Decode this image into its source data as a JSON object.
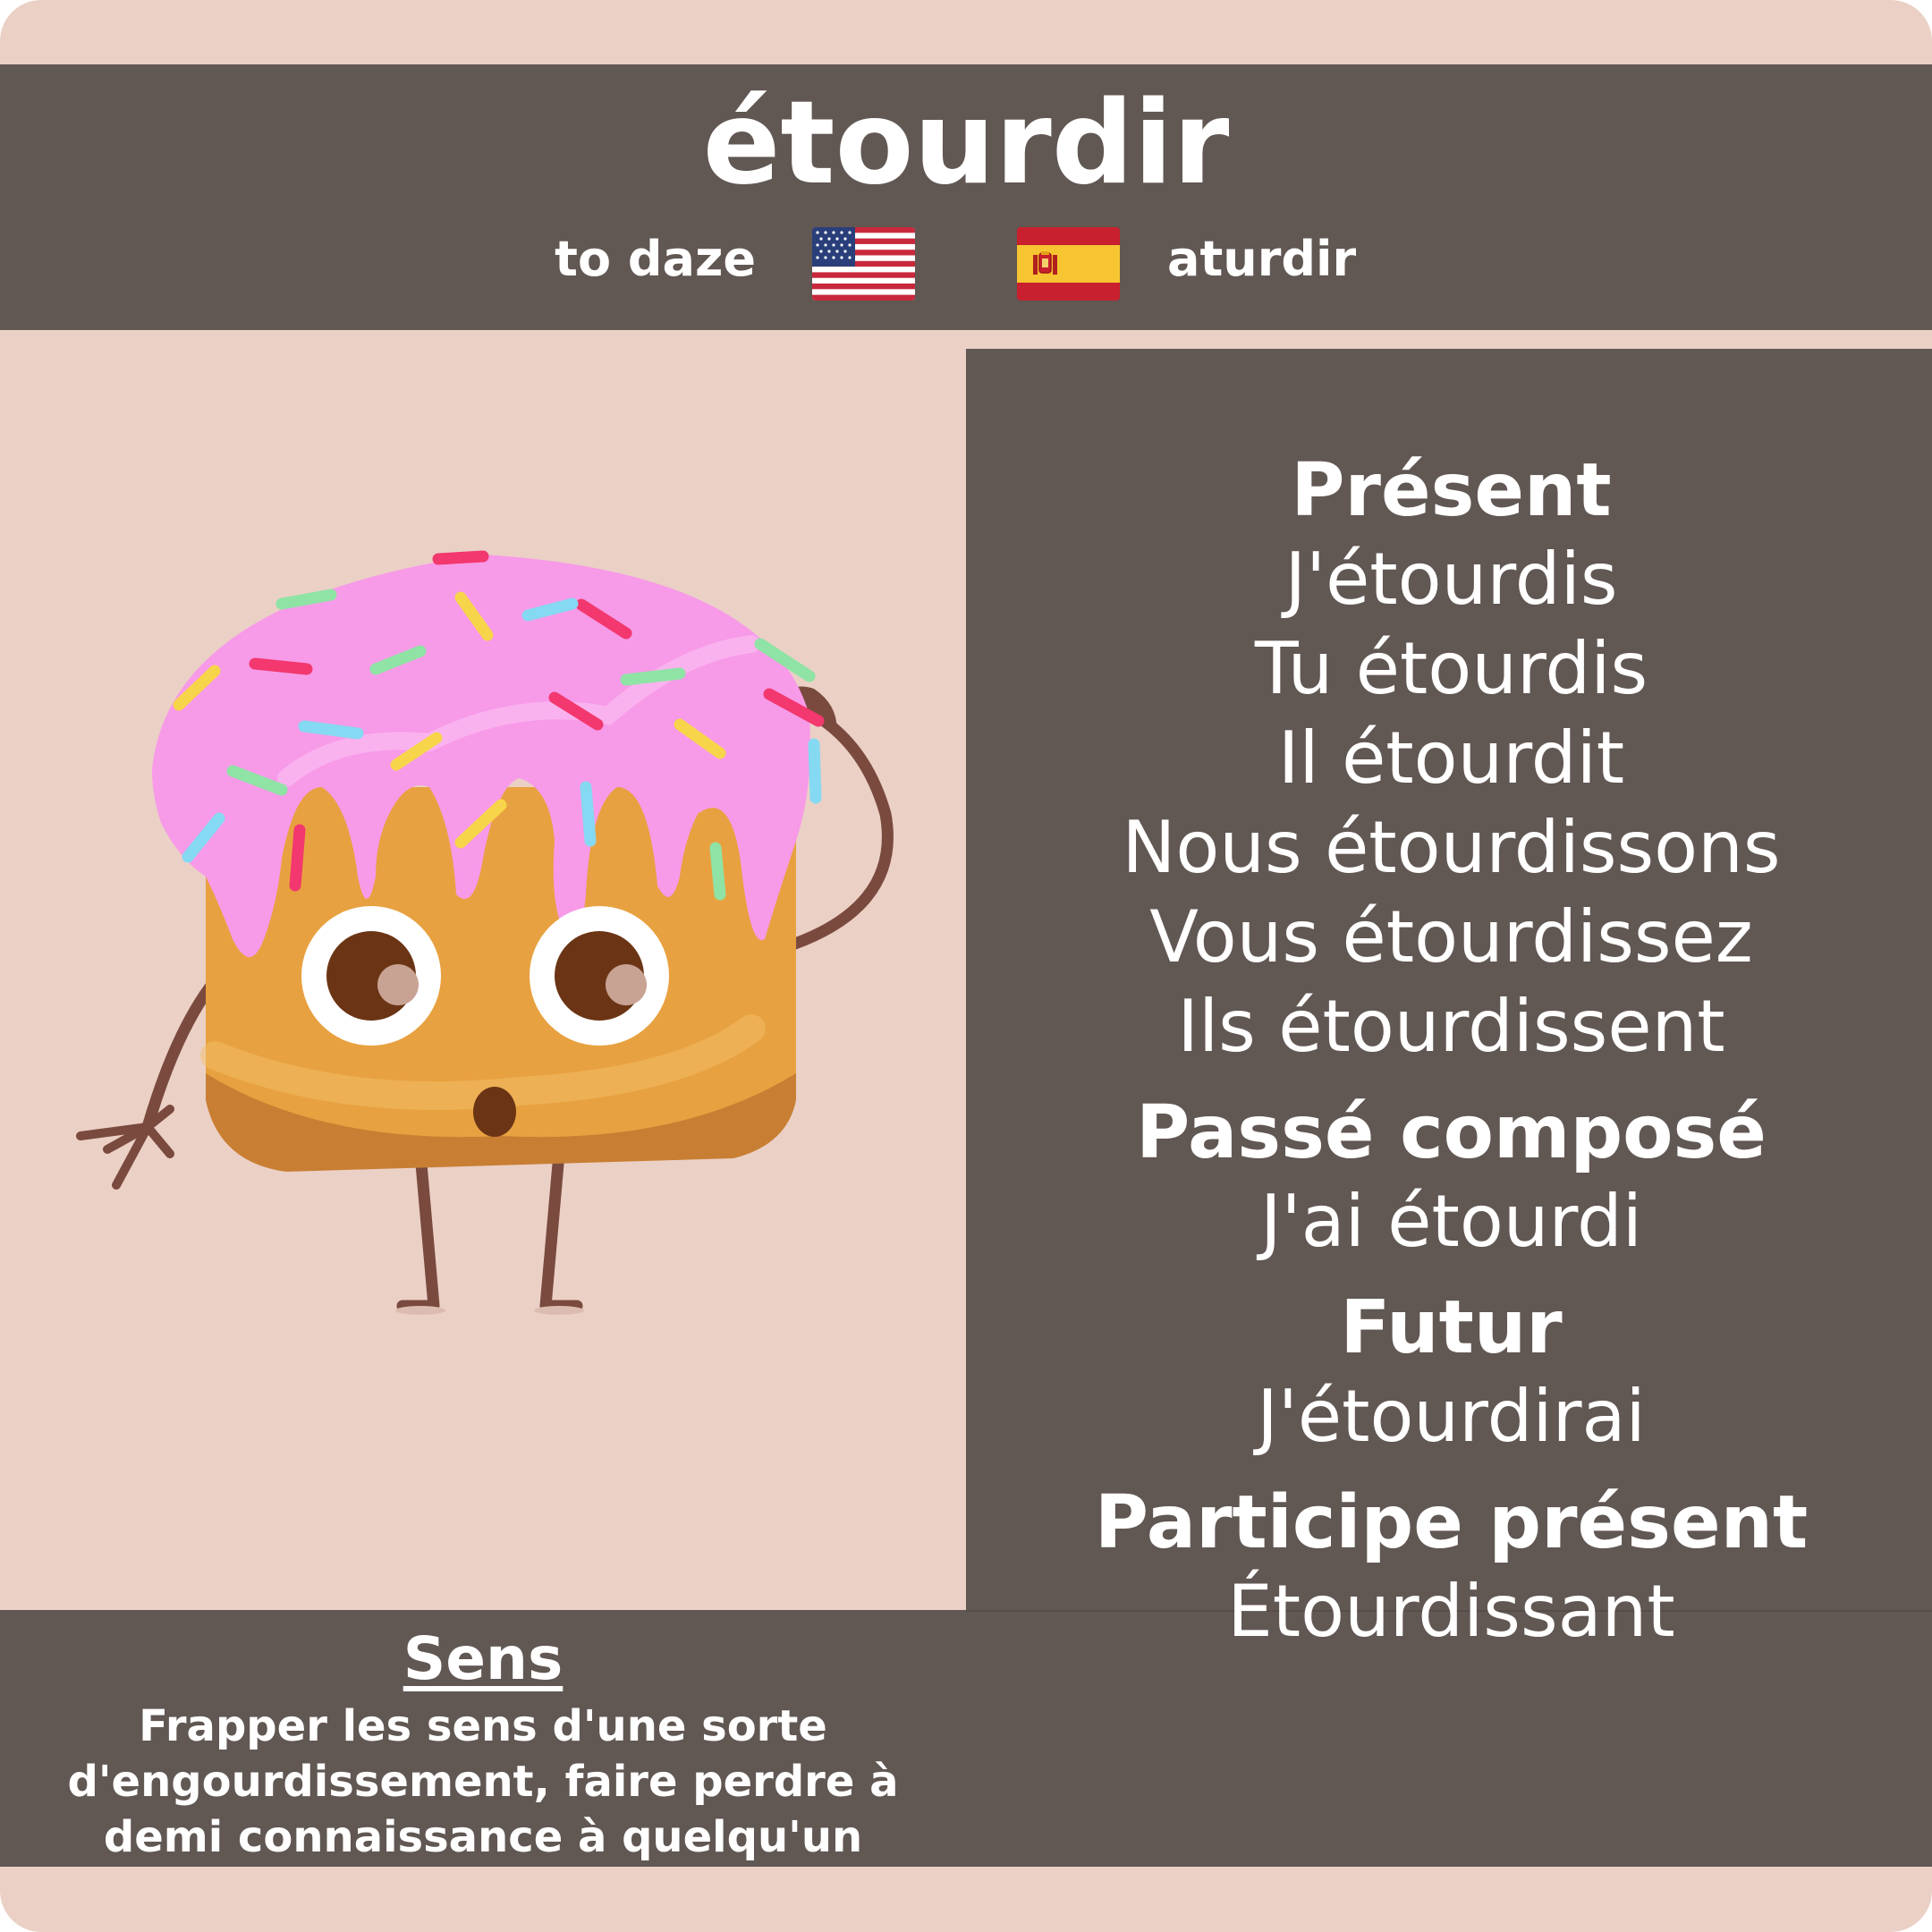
{
  "verb": "étourdir",
  "translations": {
    "english": "to daze",
    "english_flag_icon": "us-flag-icon",
    "spanish": "aturdir",
    "spanish_flag_icon": "spain-flag-icon"
  },
  "illustration": {
    "icon": "dazed-donut-cake-character"
  },
  "conjugations": {
    "present": {
      "heading": "Présent",
      "forms": [
        "J'étourdis",
        "Tu étourdis",
        "Il étourdit",
        "Nous étourdissons",
        "Vous étourdissez",
        "Ils étourdissent"
      ]
    },
    "passe_compose": {
      "heading": "Passé composé",
      "forms": [
        "J'ai étourdi"
      ]
    },
    "futur": {
      "heading": "Futur",
      "forms": [
        "J'étourdirai"
      ]
    },
    "participe_present": {
      "heading": "Participe présent",
      "forms": [
        "Étourdissant"
      ]
    }
  },
  "meaning": {
    "heading": "Sens",
    "definition": "Frapper les sens d'une sorte d'engourdissement, faire perdre à demi connaissance à quelqu'un"
  },
  "colors": {
    "background": "#ebd0c6",
    "panel": "#615753",
    "text": "#ffffff",
    "icing": "#f79ae8",
    "cake": "#e8a140",
    "limbs": "#7a4a3e"
  }
}
